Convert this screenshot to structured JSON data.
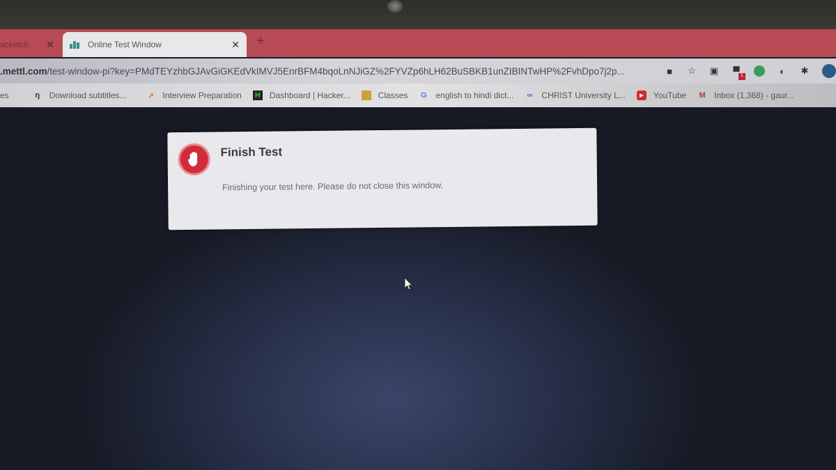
{
  "browser": {
    "tabs": [
      {
        "label": "...acketch",
        "active": false
      },
      {
        "label": "Online Test Window",
        "active": true,
        "favicon": "mettl-icon"
      }
    ],
    "new_tab_symbol": "+",
    "close_symbol": "✕",
    "address": {
      "url_domain": ".mettl.com",
      "url_path": "/test-window-pi?key=PMdTEYzhbGJAvGiGKEdVkIMVJ5EnrBFM4bqoLnNJiGZ%2FYVZp6hLH62BuSBKB1unZIBINTwHP%2FvhDpo7j2p..."
    },
    "toolbar_icons": [
      "camera-icon",
      "star-icon",
      "extension-icon",
      "extension-badge-icon",
      "green-extension-icon",
      "circle-extension-icon",
      "puzzle-icon",
      "profile-avatar"
    ],
    "toolbar_badge": "1",
    "bookmarks": [
      {
        "label": "es",
        "icon": ""
      },
      {
        "label": "Download subtitles...",
        "icon": "subtitle-icon"
      },
      {
        "label": "Interview Preparation",
        "icon": "arrow-icon"
      },
      {
        "label": "Dashboard | Hacker...",
        "icon": "hackerrank-icon"
      },
      {
        "label": "Classes",
        "icon": "classroom-icon"
      },
      {
        "label": "english to hindi dict...",
        "icon": "google-icon"
      },
      {
        "label": "CHRIST University L...",
        "icon": "infinity-icon"
      },
      {
        "label": "YouTube",
        "icon": "youtube-icon"
      },
      {
        "label": "Inbox (1,368) - gaur...",
        "icon": "gmail-icon"
      }
    ]
  },
  "modal": {
    "title": "Finish Test",
    "message": "Finishing your test here. Please do not close this window.",
    "icon": "stop-hand-icon",
    "accent_color": "#d12c3a"
  }
}
